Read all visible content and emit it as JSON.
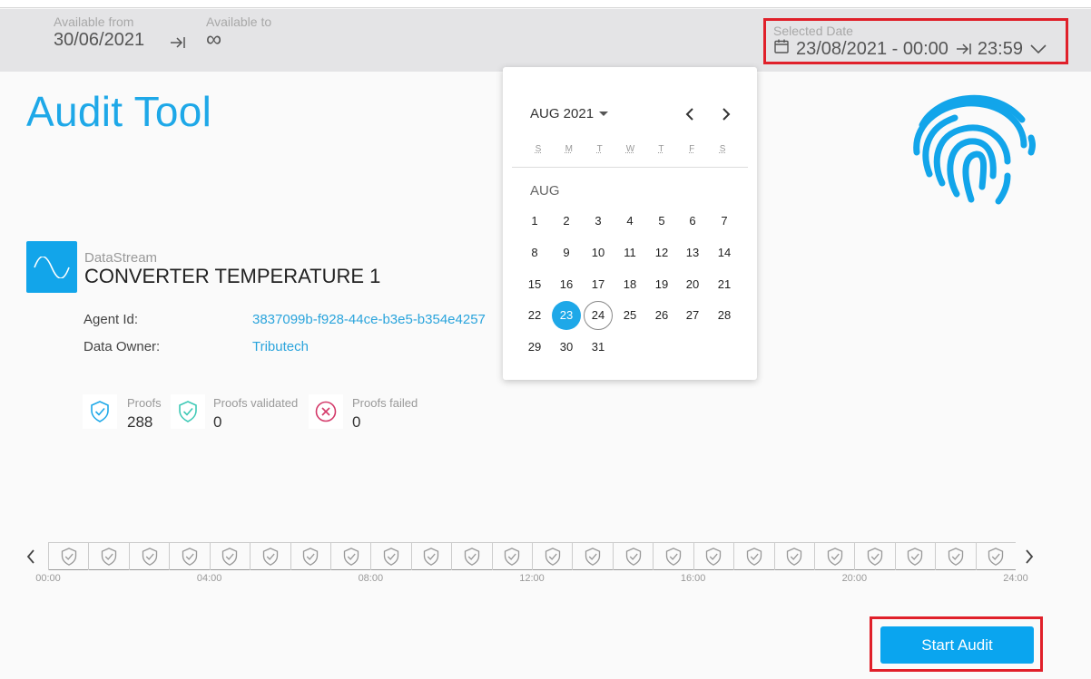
{
  "header": {
    "available_from_label": "Available from",
    "available_from_value": "30/06/2021",
    "available_to_label": "Available to",
    "available_to_value": "∞",
    "selected_date_label": "Selected Date",
    "selected_date_start": "23/08/2021 - 00:00",
    "selected_date_end": "23:59"
  },
  "page": {
    "title": "Audit Tool"
  },
  "datastream": {
    "type_label": "DataStream",
    "name": "CONVERTER TEMPERATURE 1",
    "agent_id_label": "Agent Id:",
    "agent_id_value": "3837099b-f928-44ce-b3e5-b354e4257",
    "owner_label": "Data Owner:",
    "owner_value": "Tributech"
  },
  "proofs": {
    "total_label": "Proofs",
    "total_value": "288",
    "validated_label": "Proofs validated",
    "validated_value": "0",
    "failed_label": "Proofs failed",
    "failed_value": "0"
  },
  "calendar": {
    "header": "AUG 2021",
    "weekdays": [
      "S",
      "M",
      "T",
      "W",
      "T",
      "F",
      "S"
    ],
    "month_label": "AUG",
    "days": [
      "1",
      "2",
      "3",
      "4",
      "5",
      "6",
      "7",
      "8",
      "9",
      "10",
      "11",
      "12",
      "13",
      "14",
      "15",
      "16",
      "17",
      "18",
      "19",
      "20",
      "21",
      "22",
      "23",
      "24",
      "25",
      "26",
      "27",
      "28",
      "29",
      "30",
      "31"
    ],
    "selected_day": "23",
    "today": "24"
  },
  "timeline": {
    "ticks": [
      "00:00",
      "04:00",
      "08:00",
      "12:00",
      "16:00",
      "20:00",
      "24:00"
    ],
    "segments": 24
  },
  "actions": {
    "start_audit": "Start Audit"
  },
  "colors": {
    "accent": "#1ea8e8",
    "button": "#0aa5ef",
    "highlight": "#e0202a",
    "validated": "#3ec9b6",
    "failed": "#d43a6a"
  }
}
